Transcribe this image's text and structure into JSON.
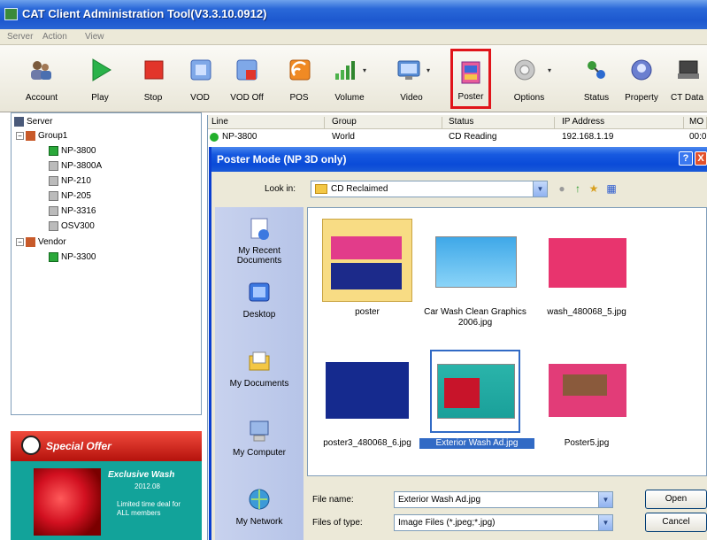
{
  "window": {
    "title": "CAT Client Administration Tool(V3.3.10.0912)"
  },
  "menu": {
    "items": [
      "Server",
      "Action",
      "View"
    ]
  },
  "toolbar": {
    "buttons": [
      {
        "label": "Account",
        "icon": "account-icon"
      },
      {
        "label": "Play",
        "icon": "play-icon"
      },
      {
        "label": "Stop",
        "icon": "stop-icon"
      },
      {
        "label": "VOD",
        "icon": "vod-icon"
      },
      {
        "label": "VOD Off",
        "icon": "vod-off-icon"
      },
      {
        "label": "POS",
        "icon": "pos-icon"
      },
      {
        "label": "Volume",
        "icon": "volume-icon"
      },
      {
        "label": "Video",
        "icon": "video-icon"
      },
      {
        "label": "Poster",
        "icon": "poster-icon"
      },
      {
        "label": "Options",
        "icon": "options-icon"
      },
      {
        "label": "Status",
        "icon": "status-icon"
      },
      {
        "label": "Property",
        "icon": "property-icon"
      },
      {
        "label": "CT Data",
        "icon": "ct-data-icon"
      }
    ]
  },
  "tree": {
    "nodes": [
      {
        "label": "Server"
      },
      {
        "label": "Group1"
      },
      {
        "label": "NP-3800"
      },
      {
        "label": "NP-3800A"
      },
      {
        "label": "NP-210"
      },
      {
        "label": "NP-205"
      },
      {
        "label": "NP-3316"
      },
      {
        "label": "OSV300"
      },
      {
        "label": "Vendor"
      },
      {
        "label": "NP-3300"
      }
    ]
  },
  "list": {
    "columns": [
      "Line",
      "Group",
      "Status",
      "IP Address",
      "MO"
    ],
    "rows": [
      {
        "line": "NP-3800",
        "group": "World",
        "status": "CD Reading",
        "ip": "192.168.1.19",
        "mo": "00:0"
      }
    ]
  },
  "offer": {
    "title": "Special Offer",
    "heading": "Exclusive Wash",
    "sub": "2012.08",
    "text": "Limited time deal for ALL members"
  },
  "dialog": {
    "title": "Poster Mode (NP 3D only)",
    "lookin_label": "Look in:",
    "lookin_value": "CD Reclaimed",
    "places": [
      "My Recent Documents",
      "Desktop",
      "My Documents",
      "My Computer",
      "My Network"
    ],
    "files": [
      {
        "name": "poster"
      },
      {
        "name": "Car Wash Clean Graphics 2006.jpg"
      },
      {
        "name": "wash_480068_5.jpg"
      },
      {
        "name": "poster3_480068_6.jpg"
      },
      {
        "name": "Exterior Wash Ad.jpg"
      },
      {
        "name": "Poster5.jpg"
      }
    ],
    "filename_label": "File name:",
    "filename_value": "Exterior Wash Ad.jpg",
    "filetype_label": "Files of type:",
    "filetype_value": "Image Files (*.jpeg;*.jpg)",
    "open_label": "Open",
    "cancel_label": "Cancel",
    "help_label": "?",
    "close_label": "X"
  }
}
